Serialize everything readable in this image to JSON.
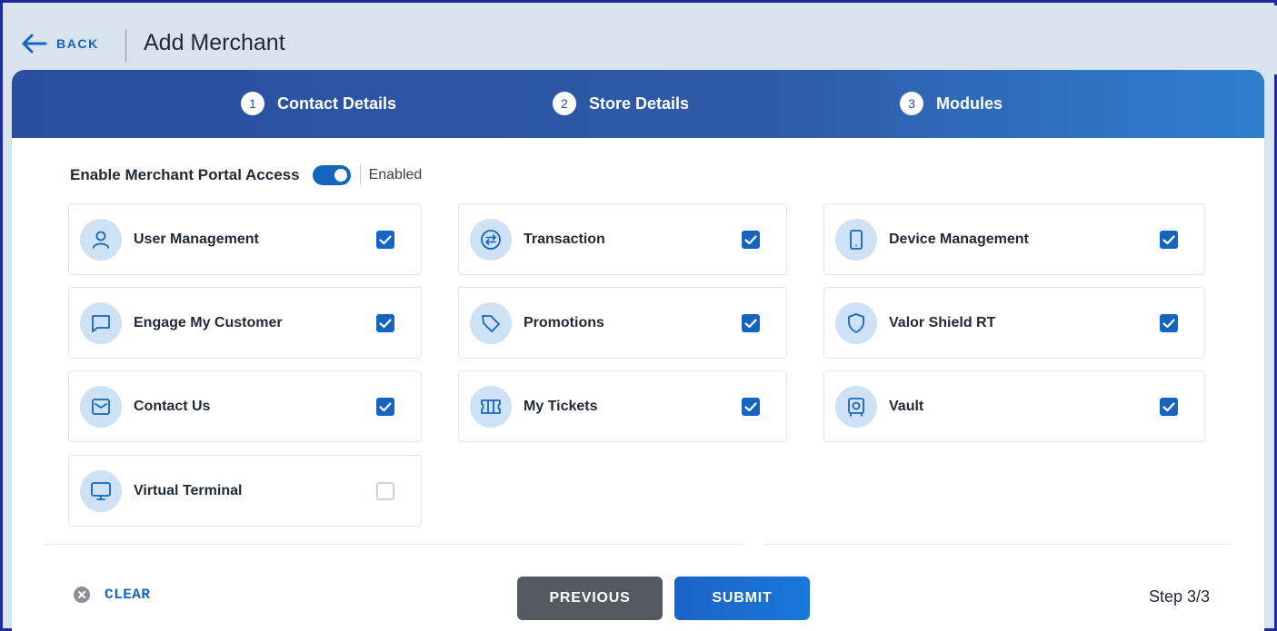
{
  "header": {
    "back_label": "BACK",
    "title": "Add Merchant"
  },
  "stepper": {
    "steps": [
      {
        "num": "1",
        "label": "Contact Details"
      },
      {
        "num": "2",
        "label": "Store Details"
      },
      {
        "num": "3",
        "label": "Modules"
      }
    ]
  },
  "portal": {
    "label": "Enable Merchant Portal Access",
    "enabled": true,
    "status": "Enabled"
  },
  "modules": [
    {
      "label": "User Management",
      "icon": "user-icon",
      "checked": true
    },
    {
      "label": "Transaction",
      "icon": "transfer-arrows-icon",
      "checked": true
    },
    {
      "label": "Device Management",
      "icon": "mobile-device-icon",
      "checked": true
    },
    {
      "label": "Engage My Customer",
      "icon": "chat-bubble-icon",
      "checked": true
    },
    {
      "label": "Promotions",
      "icon": "tag-icon",
      "checked": true
    },
    {
      "label": "Valor Shield RT",
      "icon": "shield-icon",
      "checked": true
    },
    {
      "label": "Contact Us",
      "icon": "mail-icon",
      "checked": true
    },
    {
      "label": "My Tickets",
      "icon": "ticket-icon",
      "checked": true
    },
    {
      "label": "Vault",
      "icon": "safe-icon",
      "checked": true
    },
    {
      "label": "Virtual Terminal",
      "icon": "monitor-icon",
      "checked": false
    }
  ],
  "footer": {
    "clear_label": "CLEAR",
    "previous_label": "PREVIOUS",
    "submit_label": "SUBMIT",
    "step_count": "Step 3/3"
  },
  "colors": {
    "accent": "#1565c0",
    "stepper_bg": "#2a4fa0",
    "icon_bg": "#cfe1f5",
    "page_bg": "#d9e3ee"
  }
}
